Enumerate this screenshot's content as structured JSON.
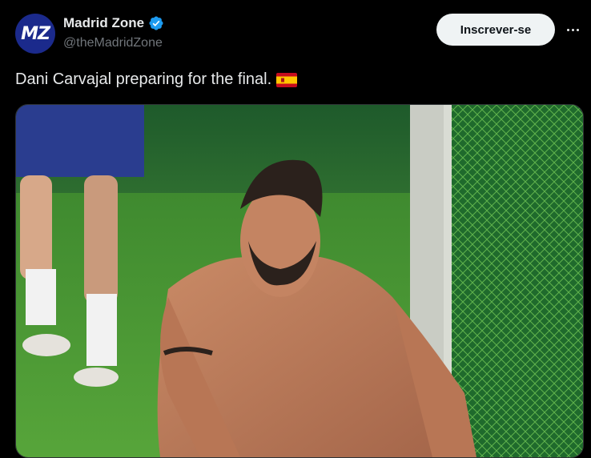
{
  "author": {
    "display_name": "Madrid Zone",
    "handle": "@theMadridZone",
    "avatar_text": "MZ",
    "verified": true
  },
  "actions": {
    "follow_label": "Inscrever-se",
    "more_icon": "more-horizontal-icon"
  },
  "tweet": {
    "text": "Dani Carvajal preparing for the final.",
    "emoji": "spain-flag"
  },
  "colors": {
    "background": "#000000",
    "text_primary": "#e7e9ea",
    "text_secondary": "#71767b",
    "verified_blue": "#1d9bf0",
    "follow_button_bg": "#eff3f4"
  }
}
